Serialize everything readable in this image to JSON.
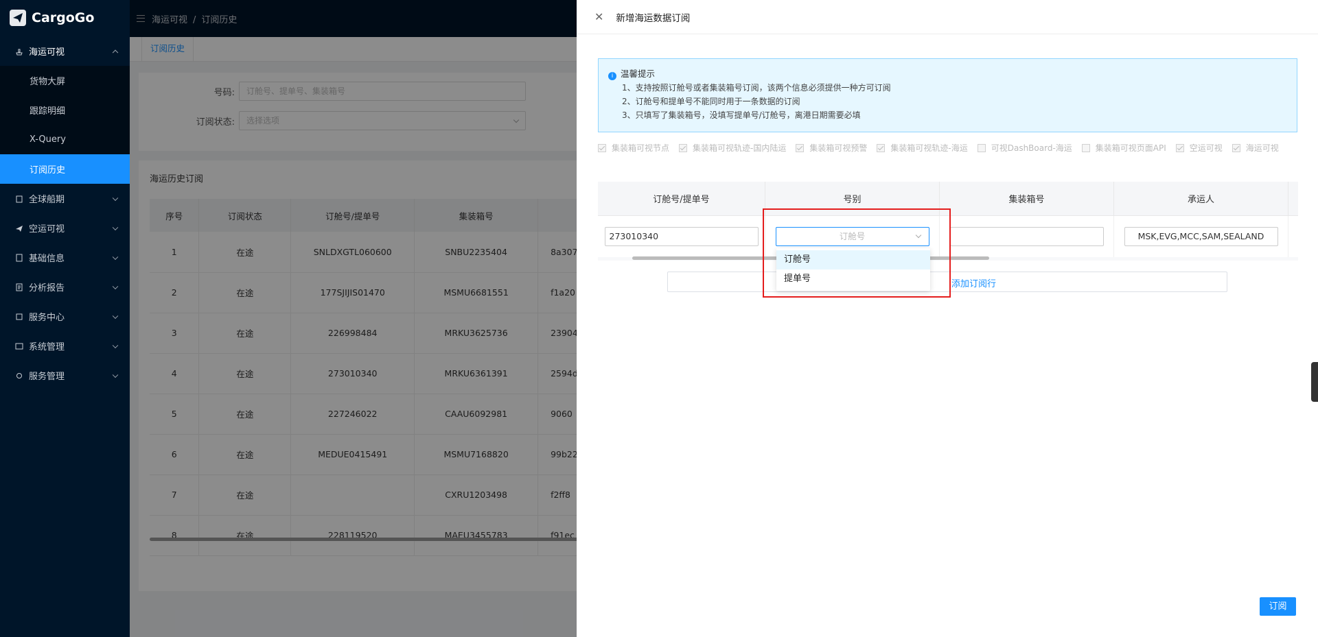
{
  "app": {
    "name": "CargoGo"
  },
  "sidebar": {
    "groups": [
      {
        "label": "海运可视",
        "icon": "ship-icon",
        "open": true,
        "items": [
          {
            "label": "货物大屏",
            "active": false
          },
          {
            "label": "跟踪明细",
            "active": false
          },
          {
            "label": "X-Query",
            "active": false
          },
          {
            "label": "订阅历史",
            "active": true
          }
        ]
      },
      {
        "label": "全球船期",
        "icon": "calendar-icon"
      },
      {
        "label": "空运可视",
        "icon": "plane-icon"
      },
      {
        "label": "基础信息",
        "icon": "document-icon"
      },
      {
        "label": "分析报告",
        "icon": "report-icon"
      },
      {
        "label": "服务中心",
        "icon": "service-icon"
      },
      {
        "label": "系统管理",
        "icon": "system-icon"
      },
      {
        "label": "服务管理",
        "icon": "gear-icon"
      }
    ]
  },
  "topbar": {
    "breadcrumb": [
      "海运可视",
      "订阅历史"
    ]
  },
  "tabs": [
    "订阅历史"
  ],
  "filter": {
    "number_label": "号码:",
    "number_placeholder": "订舱号、提单号、集装箱号",
    "status_label": "订阅状态:",
    "status_placeholder": "选择选项"
  },
  "history": {
    "title": "海运历史订阅",
    "columns": [
      "序号",
      "订阅状态",
      "订舱号/提单号",
      "集装箱号"
    ],
    "rows": [
      {
        "no": "1",
        "status": "在途",
        "booking": "SNLDXGTL060600",
        "container": "SNBU2235404",
        "extra": "8a307"
      },
      {
        "no": "2",
        "status": "在途",
        "booking": "177SJIJIS01470",
        "container": "MSMU6681551",
        "extra": "f1a20"
      },
      {
        "no": "3",
        "status": "在途",
        "booking": "226998484",
        "container": "MRKU3625736",
        "extra": "23904"
      },
      {
        "no": "4",
        "status": "在途",
        "booking": "273010340",
        "container": "MRKU6361391",
        "extra": "2594d"
      },
      {
        "no": "5",
        "status": "在途",
        "booking": "227246022",
        "container": "CAAU6092981",
        "extra": "9060"
      },
      {
        "no": "6",
        "status": "在途",
        "booking": "MEDUE0415491",
        "container": "MSMU7168820",
        "extra": "99b22"
      },
      {
        "no": "7",
        "status": "在途",
        "booking": "",
        "container": "CXRU1203498",
        "extra": "f2ff8"
      },
      {
        "no": "8",
        "status": "在途",
        "booking": "228119520",
        "container": "MAEU3455783",
        "extra": "f91ec"
      }
    ]
  },
  "drawer": {
    "title": "新增海运数据订阅",
    "tip": {
      "title": "温馨提示",
      "lines": [
        "1、支持按照订舱号或者集装箱号订阅，该两个信息必须提供一种方可订阅",
        "2、订舱号和提单号不能同时用于一条数据的订阅",
        "3、只填写了集装箱号，没填写提单号/订舱号，离港日期需要必填"
      ]
    },
    "checks": [
      {
        "label": "集装箱可视节点",
        "checked": true
      },
      {
        "label": "集装箱可视轨迹-国内陆运",
        "checked": true
      },
      {
        "label": "集装箱可视预警",
        "checked": true
      },
      {
        "label": "集装箱可视轨迹-海运",
        "checked": true
      },
      {
        "label": "可视DashBoard-海运",
        "checked": false
      },
      {
        "label": "集装箱可视页面API",
        "checked": false
      },
      {
        "label": "空运可视",
        "checked": true
      },
      {
        "label": "海运可视",
        "checked": true
      }
    ],
    "table": {
      "columns": [
        "订舱号/提单号",
        "号别",
        "集装箱号",
        "承运人"
      ],
      "row": {
        "booking": "273010340",
        "type_placeholder": "订舱号",
        "container": "",
        "carrier": "MSK,EVG,MCC,SAM,SEALAND"
      }
    },
    "add_row": "添加订阅行",
    "dropdown_options": [
      "订舱号",
      "提单号"
    ],
    "submit": "订阅"
  },
  "colors": {
    "sidebar_bg": "#001529",
    "accent": "#1890ff",
    "highlight": "#e41c1c"
  }
}
